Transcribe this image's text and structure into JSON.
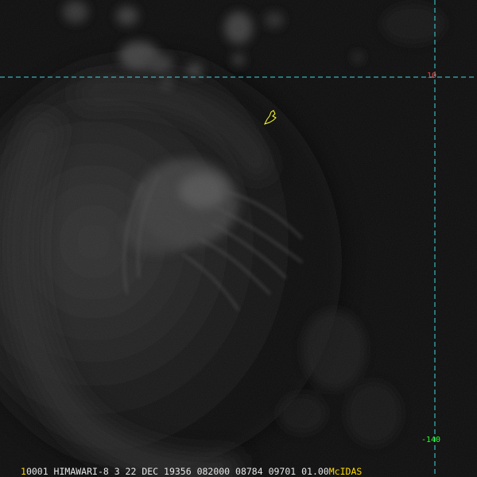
{
  "grid": {
    "line_color": "#3fd8e0",
    "lat_label": "10",
    "lon_label": "-140",
    "lat_label_color": "#ff3a3a",
    "lon_label_color": "#2aff2a"
  },
  "coastline": {
    "color": "#ffff33",
    "name": "island-outline"
  },
  "footer": {
    "frame": "1",
    "info": "0001 HIMAWARI-8   3 22 DEC 19356 082000 08784 09701 01.00",
    "brand": "McIDAS",
    "frame_color": "#ffd800",
    "brand_color": "#ffd800"
  }
}
